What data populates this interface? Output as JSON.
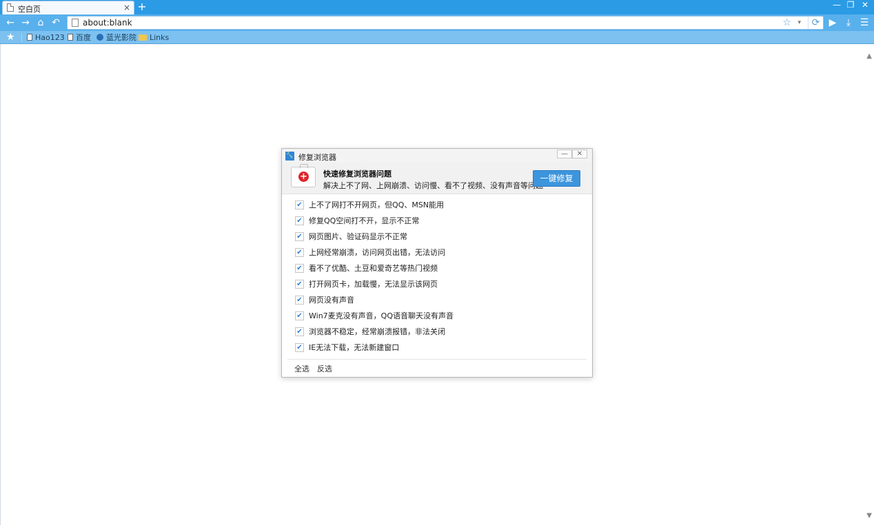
{
  "tab": {
    "title": "空白页",
    "close": "×",
    "new_tab": "+"
  },
  "window_controls": {
    "minimize": "—",
    "restore": "❐",
    "close": "✕"
  },
  "toolbar": {
    "back": "←",
    "forward": "→",
    "home": "⌂",
    "undo": "↶",
    "url": "about:blank",
    "star": "☆",
    "caret": "▾",
    "refresh": "⟳",
    "play": "▶",
    "download": "⤓",
    "menu": "☰"
  },
  "bookmarks": {
    "star": "★",
    "items": [
      {
        "label": "Hao123",
        "icon": "page-icon"
      },
      {
        "label": "百度",
        "icon": "page-icon"
      },
      {
        "label": "蓝光影院",
        "icon": "globe-icon"
      },
      {
        "label": "Links",
        "icon": "folder-icon"
      }
    ]
  },
  "scrollbar": {
    "up": "▲",
    "down": "▼"
  },
  "dialog": {
    "title": "修复浏览器",
    "title_icon": "wrench-icon",
    "minimize": "—",
    "close": "✕",
    "header_title": "快速修复浏览器问题",
    "header_sub": "解决上不了网、上网崩溃、访问慢、看不了视频、没有声音等问题",
    "kit_cross": "+",
    "repair_button": "一键修复",
    "check_mark": "✔",
    "options": [
      "上不了网打不开网页，但QQ、MSN能用",
      "修复QQ空间打不开，显示不正常",
      "网页图片、验证码显示不正常",
      "上网经常崩溃，访问网页出错，无法访问",
      "看不了优酷、土豆和爱奇艺等热门视频",
      "打开网页卡，加载慢，无法显示该网页",
      "网页没有声音",
      "Win7麦克没有声音，QQ语音聊天没有声音",
      "浏览器不稳定，经常崩溃报错，非法关闭",
      "IE无法下载，无法新建窗口"
    ],
    "select_all": "全选",
    "invert_select": "反选"
  }
}
